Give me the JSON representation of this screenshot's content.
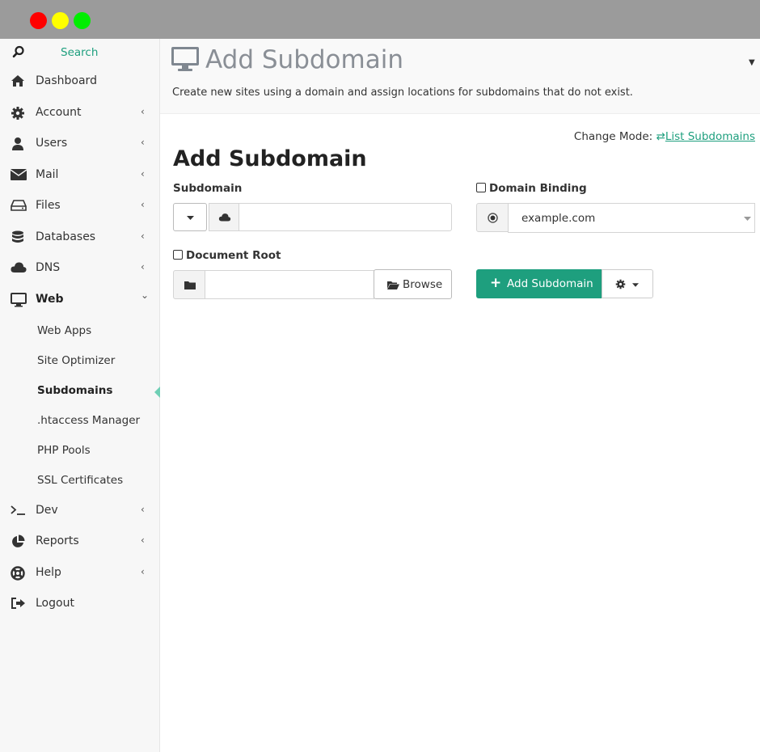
{
  "window": {
    "controls": [
      "close",
      "minimize",
      "maximize"
    ]
  },
  "sidebar": {
    "search_label": "Search",
    "items": [
      {
        "label": "Dashboard",
        "icon": "home-icon",
        "chevron": ""
      },
      {
        "label": "Account",
        "icon": "gear-icon",
        "chevron": "‹"
      },
      {
        "label": "Users",
        "icon": "user-icon",
        "chevron": "‹"
      },
      {
        "label": "Mail",
        "icon": "envelope-icon",
        "chevron": "‹"
      },
      {
        "label": "Files",
        "icon": "drive-icon",
        "chevron": "‹"
      },
      {
        "label": "Databases",
        "icon": "database-icon",
        "chevron": "‹"
      },
      {
        "label": "DNS",
        "icon": "cloud-icon",
        "chevron": "‹"
      },
      {
        "label": "Web",
        "icon": "monitor-icon",
        "chevron": "⌄"
      }
    ],
    "web_sub": [
      {
        "label": "Web Apps"
      },
      {
        "label": "Site Optimizer"
      },
      {
        "label": "Subdomains"
      },
      {
        "label": ".htaccess Manager"
      },
      {
        "label": "PHP Pools"
      },
      {
        "label": "SSL Certificates"
      }
    ],
    "items_after": [
      {
        "label": "Dev",
        "icon": "terminal-icon",
        "chevron": "‹"
      },
      {
        "label": "Reports",
        "icon": "pie-chart-icon",
        "chevron": "‹"
      },
      {
        "label": "Help",
        "icon": "lifebuoy-icon",
        "chevron": "‹"
      },
      {
        "label": "Logout",
        "icon": "sign-out-icon",
        "chevron": ""
      }
    ]
  },
  "header": {
    "title": "Add Subdomain",
    "description": "Create new sites using a domain and assign locations for subdomains that do not exist."
  },
  "main": {
    "change_mode_label": "Change Mode:",
    "change_mode_link": "List Subdomains",
    "heading": "Add Subdomain",
    "subdomain_label": "Subdomain",
    "subdomain_value": "",
    "domain_binding_label": "Domain Binding",
    "domain_value": "example.com",
    "document_root_label": "Document Root",
    "document_root_value": "",
    "browse_label": "Browse",
    "add_button_label": "Add Subdomain"
  },
  "colors": {
    "accent": "#1e9f7e",
    "title_bar": "#9b9b9b"
  }
}
